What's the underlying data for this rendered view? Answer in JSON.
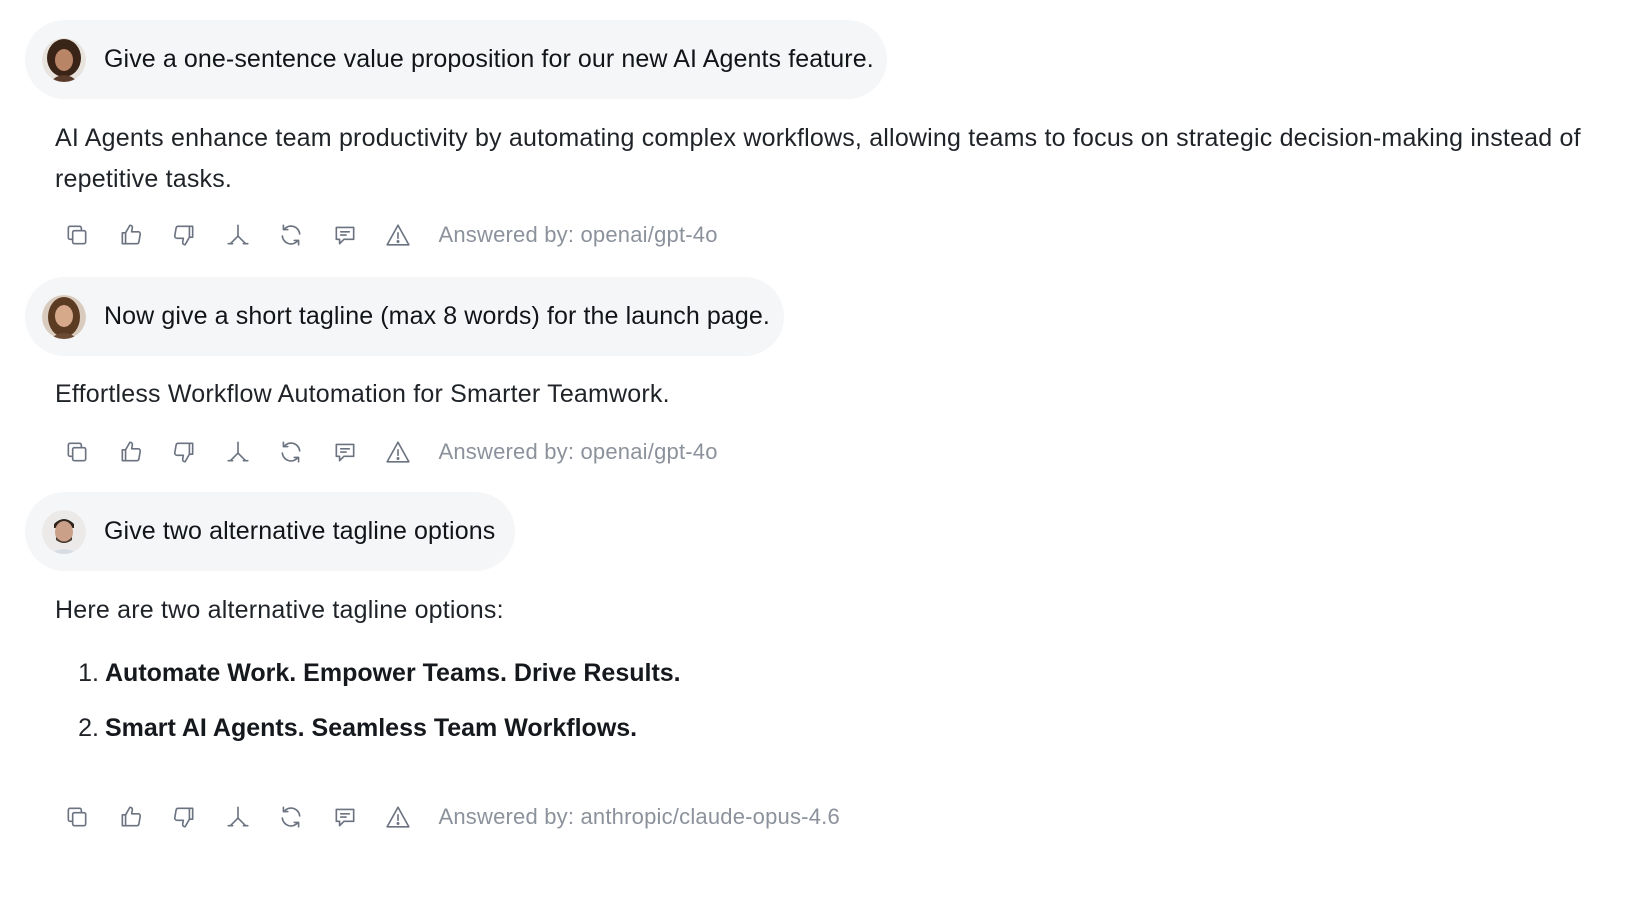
{
  "conversation": [
    {
      "user": {
        "avatar": "avatar-woman-curly-hair",
        "text": "Give a one-sentence value proposition for our new AI Agents feature."
      },
      "assistant": {
        "text": "AI Agents enhance team productivity by automating complex workflows, allowing teams to focus on strategic decision-making instead of repetitive tasks.",
        "answered_by": "Answered by: openai/gpt-4o"
      }
    },
    {
      "user": {
        "avatar": "avatar-woman-long-hair",
        "text": "Now give a short tagline (max 8 words) for the launch page."
      },
      "assistant": {
        "text": "Effortless Workflow Automation for Smarter Teamwork.",
        "answered_by": "Answered by: openai/gpt-4o"
      }
    },
    {
      "user": {
        "avatar": "avatar-man-beard",
        "text": "Give two alternative tagline options"
      },
      "assistant": {
        "intro": "Here are two alternative tagline options:",
        "options": [
          {
            "num": "1.",
            "text": "Automate Work. Empower Teams. Drive Results."
          },
          {
            "num": "2.",
            "text": "Smart AI Agents. Seamless Team Workflows."
          }
        ],
        "answered_by": "Answered by: anthropic/claude-opus-4.6"
      }
    }
  ],
  "actions": [
    "copy-icon",
    "thumbs-up-icon",
    "thumbs-down-icon",
    "branch-icon",
    "regenerate-icon",
    "comment-icon",
    "warning-icon"
  ],
  "colors": {
    "bubble_bg": "#f5f6f8",
    "icon": "#6b7280",
    "meta_text": "#8c929c",
    "text": "#1f2328"
  }
}
